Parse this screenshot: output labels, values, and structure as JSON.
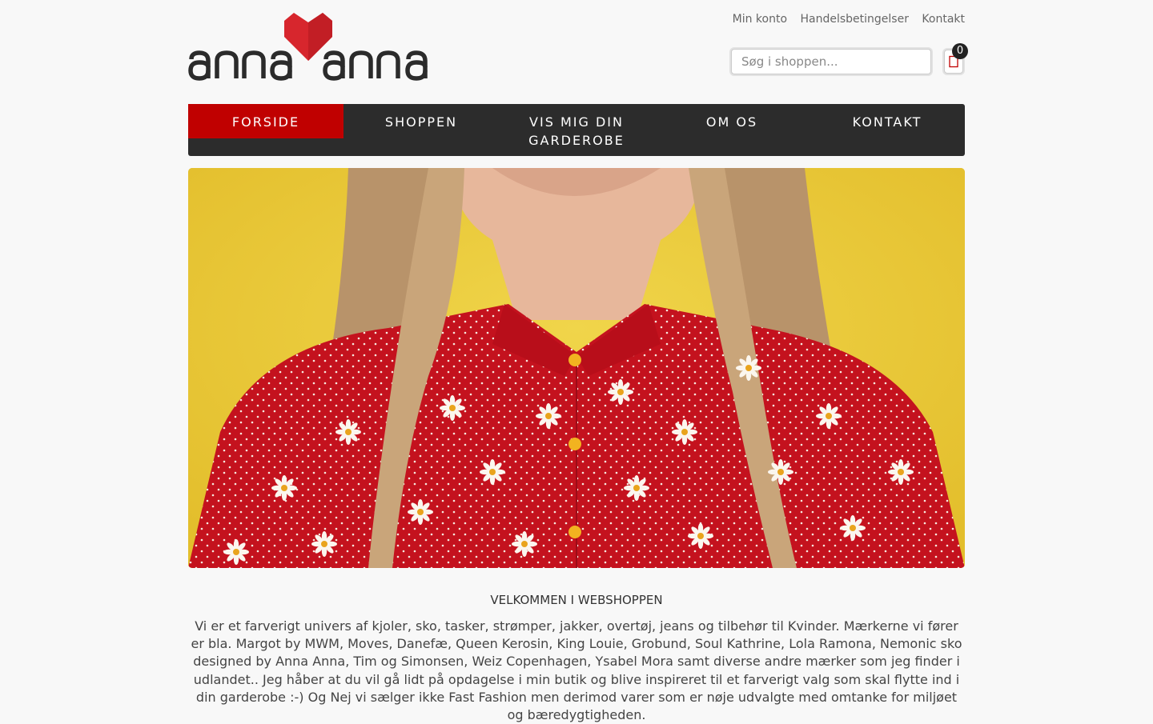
{
  "brand": {
    "logo_text": "anna anna",
    "heart_color": "#d7262d"
  },
  "top_links": [
    "Min konto",
    "Handelsbetingelser",
    "Kontakt"
  ],
  "search": {
    "placeholder": "Søg i shoppen..."
  },
  "cart": {
    "count": "0",
    "icon": "cart-icon"
  },
  "nav": {
    "active_color": "#c00000",
    "bar_color": "#2c2c2c",
    "items": [
      "FORSIDE",
      "SHOPPEN",
      "VIS MIG DIN GARDEROBE",
      "OM OS",
      "KONTAKT"
    ]
  },
  "hero": {
    "background_color": "#e9c73a",
    "shirt_color": "#c4121e"
  },
  "intro": {
    "title": "VELKOMMEN I WEBSHOPPEN",
    "text": "Vi er et farverigt univers af kjoler, sko, tasker, strømper, jakker, overtøj, jeans og tilbehør til Kvinder. Mærkerne vi fører er bla. Margot by MWM, Moves,  Danefæ, Queen Kerosin, King Louie, Grobund, Soul Kathrine, Lola Ramona, Nemonic sko designed by Anna Anna,  Tim og Simonsen, Weiz Copenhagen, Ysabel Mora samt diverse andre mærker som jeg finder i udlandet.. Jeg håber at du vil gå lidt på opdagelse i min butik og blive inspireret til et farverigt valg som skal flytte ind i din garderobe :-) Og Nej vi sælger ikke Fast Fashion men derimod varer som er nøje udvalgte med omtanke for miljøet og bæredygtigheden."
  }
}
